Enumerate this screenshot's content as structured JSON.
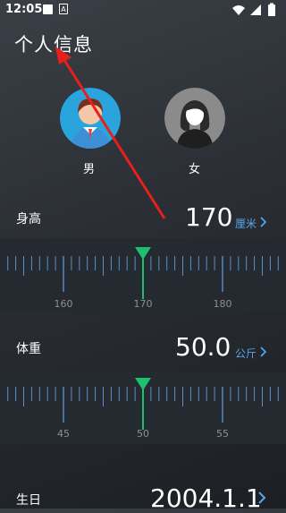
{
  "status": {
    "time": "12:05"
  },
  "page": {
    "title": "个人信息"
  },
  "gender": {
    "male_label": "男",
    "female_label": "女"
  },
  "height": {
    "label": "身高",
    "value": "170",
    "unit": "厘米",
    "ticks": [
      "160",
      "170",
      "180"
    ]
  },
  "weight": {
    "label": "体重",
    "value": "50.0",
    "unit": "公斤",
    "ticks": [
      "45",
      "50",
      "55"
    ]
  },
  "birthday": {
    "label": "生日",
    "value": "2004.1.1"
  },
  "colors": {
    "accent_green": "#1fbf73",
    "link_blue": "#5aa7e8",
    "ruler_tick": "#5a8fc8"
  }
}
